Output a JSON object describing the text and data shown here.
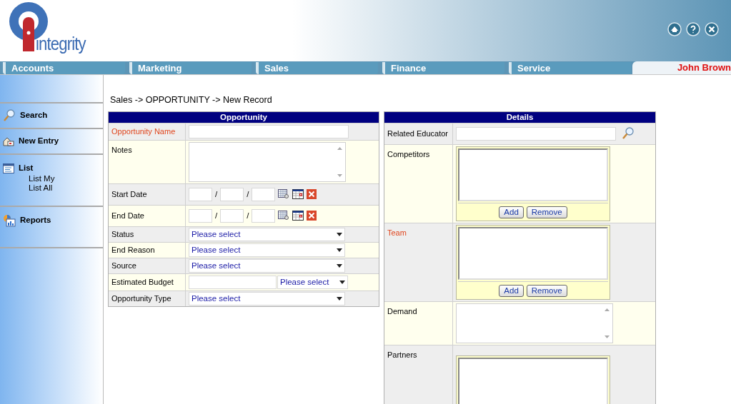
{
  "header": {
    "logo_text": "integrity",
    "icons": [
      {
        "kind": "home"
      },
      {
        "kind": "help"
      },
      {
        "kind": "close"
      }
    ]
  },
  "tabs": [
    {
      "label": "Accounts"
    },
    {
      "label": "Marketing"
    },
    {
      "label": "Sales"
    },
    {
      "label": "Finance"
    },
    {
      "label": "Service"
    }
  ],
  "user_name": "John Brown",
  "sidebar": {
    "items": [
      {
        "label": "Search",
        "kind": "search"
      },
      {
        "label": "New Entry",
        "kind": "new"
      },
      {
        "label": "List",
        "kind": "list",
        "children": [
          {
            "label": "List My"
          },
          {
            "label": "List All"
          }
        ]
      },
      {
        "label": "Reports",
        "kind": "reports"
      }
    ]
  },
  "breadcrumb": "Sales -> OPPORTUNITY -> New Record",
  "opportunity": {
    "title": "Opportunity",
    "rows": [
      {
        "label": "Opportunity Name",
        "kind": "text",
        "required": true
      },
      {
        "label": "Notes",
        "kind": "textarea",
        "required": false
      },
      {
        "label": "Start Date",
        "kind": "date",
        "separator": "/",
        "required": false
      },
      {
        "label": "End Date",
        "kind": "date",
        "separator": "/",
        "required": false
      },
      {
        "label": "Status",
        "kind": "select",
        "value": "Please select",
        "required": false
      },
      {
        "label": "End Reason",
        "kind": "select",
        "value": "Please select",
        "required": false
      },
      {
        "label": "Source",
        "kind": "select",
        "value": "Please select",
        "required": false
      },
      {
        "label": "Estimated Budget",
        "kind": "budget",
        "value": "Please select",
        "required": false
      },
      {
        "label": "Opportunity Type",
        "kind": "select",
        "value": "Please select",
        "required": false
      }
    ]
  },
  "details": {
    "title": "Details",
    "rows": [
      {
        "label": "Related Educator",
        "kind": "lookup",
        "required": false
      },
      {
        "label": "Competitors",
        "kind": "picker",
        "buttons": [
          "Add",
          "Remove"
        ],
        "required": false
      },
      {
        "label": "Team",
        "kind": "picker",
        "buttons": [
          "Add",
          "Remove"
        ],
        "required": true
      },
      {
        "label": "Demand",
        "kind": "textarea",
        "required": false
      },
      {
        "label": "Partners",
        "kind": "picker",
        "required": false
      }
    ]
  }
}
